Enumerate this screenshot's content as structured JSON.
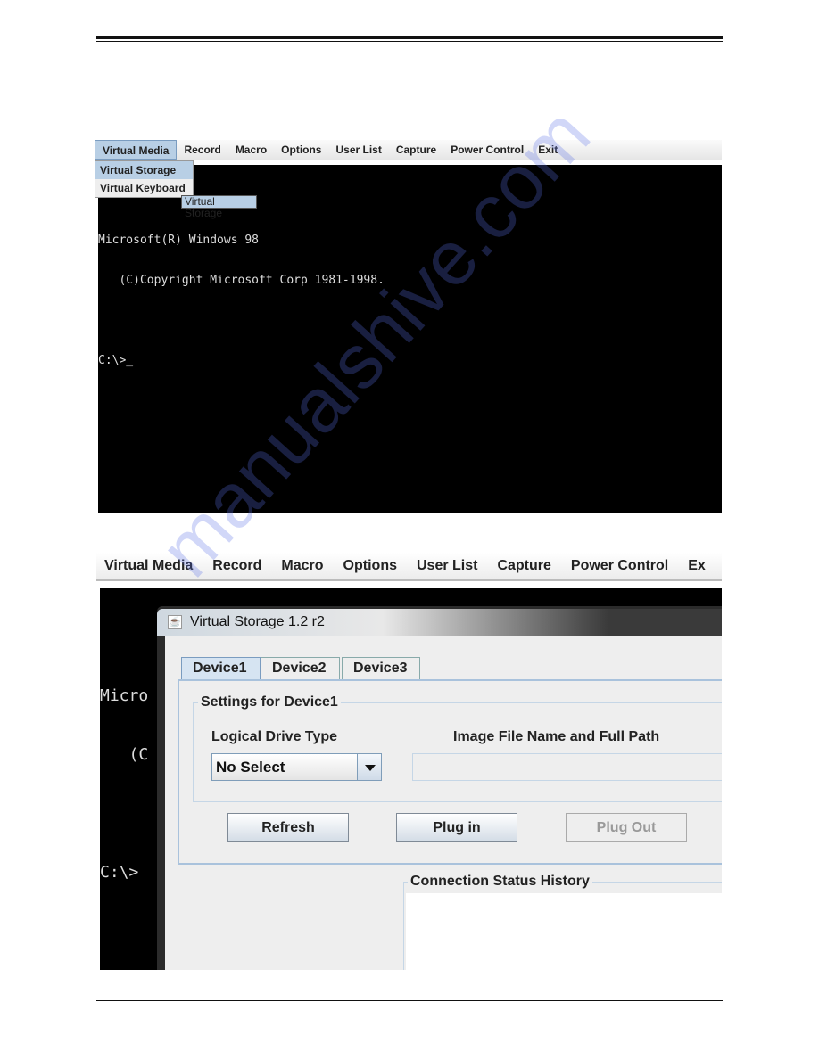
{
  "screenshot1": {
    "menu": [
      "Virtual Media",
      "Record",
      "Macro",
      "Options",
      "User List",
      "Capture",
      "Power Control",
      "Exit"
    ],
    "dropdown_items": [
      "Virtual Storage",
      "Virtual Keyboard"
    ],
    "tooltip": "Virtual Storage",
    "terminal_lines": [
      "Microsoft(R) Windows 98",
      "   (C)Copyright Microsoft Corp 1981-1998.",
      "",
      "C:\\>_"
    ]
  },
  "screenshot2": {
    "menu": [
      "Virtual Media",
      "Record",
      "Macro",
      "Options",
      "User List",
      "Capture",
      "Power Control",
      "Ex"
    ],
    "terminal_lines": [
      "Micro",
      "   (C",
      "",
      "C:\\>"
    ],
    "dialog": {
      "title": "Virtual Storage 1.2 r2",
      "tabs": [
        "Device1",
        "Device2",
        "Device3"
      ],
      "active_tab": "Device1",
      "group_title": "Settings for Device1",
      "drive_type_label": "Logical Drive Type",
      "drive_type_value": "No Select",
      "image_path_label": "Image File Name and Full Path",
      "image_path_value": "",
      "buttons": {
        "refresh": "Refresh",
        "plug_in": "Plug in",
        "plug_out": "Plug Out"
      },
      "status_title": "Connection Status History"
    }
  },
  "watermark": "manualshive.com",
  "colors": {
    "menu_highlight": "#b8cfe5",
    "terminal_bg": "#000000",
    "dialog_bg": "#eeeeee"
  }
}
